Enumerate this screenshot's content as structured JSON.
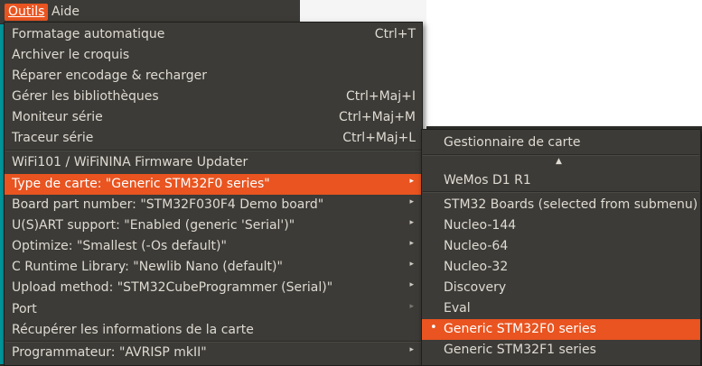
{
  "menubar": {
    "outils": "Outils",
    "aide": "Aide"
  },
  "tools_menu": {
    "items": [
      {
        "label": "Formatage automatique",
        "shortcut": "Ctrl+T"
      },
      {
        "label": "Archiver le croquis",
        "shortcut": ""
      },
      {
        "label": "Réparer encodage & recharger",
        "shortcut": ""
      },
      {
        "label": "Gérer les bibliothèques",
        "shortcut": "Ctrl+Maj+I"
      },
      {
        "label": "Moniteur série",
        "shortcut": "Ctrl+Maj+M"
      },
      {
        "label": "Traceur série",
        "shortcut": "Ctrl+Maj+L"
      },
      {
        "label": "WiFi101 / WiFiNINA Firmware Updater",
        "shortcut": ""
      },
      {
        "label": "Type de carte: \"Generic STM32F0 series\"",
        "shortcut": ""
      },
      {
        "label": "Board part number: \"STM32F030F4 Demo board\"",
        "shortcut": ""
      },
      {
        "label": "U(S)ART support: \"Enabled (generic 'Serial')\"",
        "shortcut": ""
      },
      {
        "label": "Optimize: \"Smallest (-Os default)\"",
        "shortcut": ""
      },
      {
        "label": "C Runtime Library: \"Newlib Nano (default)\"",
        "shortcut": ""
      },
      {
        "label": "Upload method: \"STM32CubeProgrammer (Serial)\"",
        "shortcut": ""
      },
      {
        "label": "Port",
        "shortcut": ""
      },
      {
        "label": "Récupérer les informations de la carte",
        "shortcut": ""
      },
      {
        "label": "Programmateur: \"AVRISP mkII\"",
        "shortcut": ""
      }
    ]
  },
  "board_menu": {
    "items": [
      {
        "label": "Gestionnaire de carte"
      },
      {
        "label": "WeMos D1 R1"
      },
      {
        "label": "STM32 Boards (selected from submenu)"
      },
      {
        "label": "Nucleo-144"
      },
      {
        "label": "Nucleo-64"
      },
      {
        "label": "Nucleo-32"
      },
      {
        "label": "Discovery"
      },
      {
        "label": "Eval"
      },
      {
        "label": "Generic STM32F0 series"
      },
      {
        "label": "Generic STM32F1 series"
      }
    ]
  },
  "icons": {
    "submenu_arrow": "▸",
    "scroll_up": "▲",
    "selected_dot": "•"
  },
  "colors": {
    "accent": "#e95420",
    "menu_bg": "#3c3b37",
    "text": "#dfdbd2"
  }
}
